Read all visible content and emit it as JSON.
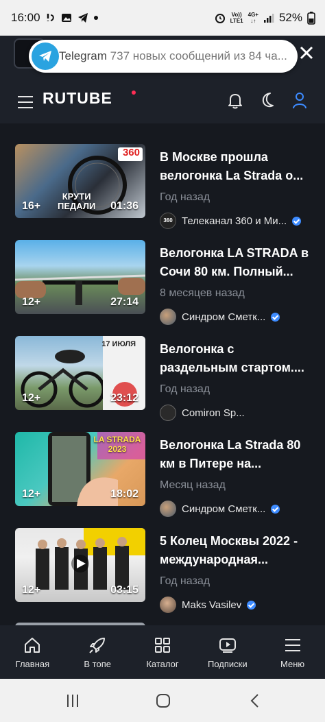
{
  "status_bar": {
    "time": "16:00",
    "network_top": "Vo))",
    "network_bottom": "LTE1",
    "network2_top": "4G+",
    "battery": "52%"
  },
  "notification": {
    "app": "Telegram",
    "message": "737 новых сообщений из 84 ча..."
  },
  "header": {
    "brand": "RUTUBE"
  },
  "videos": [
    {
      "title": "В Москве прошла велогонка La Strada о...",
      "date": "Год назад",
      "channel": "Телеканал 360 и Ми...",
      "age": "16+",
      "duration": "01:36",
      "overlay_text": "КРУТИ\nПЕДАЛИ",
      "corner_logo": "360",
      "verified": true
    },
    {
      "title": "Велогонка LA STRADA в Сочи 80 км. Полный...",
      "date": "8 месяцев назад",
      "channel": "Синдром Сметк...",
      "age": "12+",
      "duration": "27:14",
      "verified": true
    },
    {
      "title": "Велогонка с раздельным стартом....",
      "date": "Год назад",
      "channel": "Comiron Sp...",
      "age": "12+",
      "duration": "23:12",
      "overlay_text": "17 ИЮЛЯ",
      "verified": false
    },
    {
      "title": "Велогонка La Strada 80 км в Питере на...",
      "date": "Месяц назад",
      "channel": "Синдром Сметк...",
      "age": "12+",
      "duration": "18:02",
      "overlay_text": "LA STRADA 2023",
      "verified": true
    },
    {
      "title": "5 Колец Москвы 2022 - международная...",
      "date": "Год назад",
      "channel": "Maks Vasilev",
      "age": "12+",
      "duration": "03:15",
      "verified": true
    }
  ],
  "bottom_nav": [
    {
      "label": "Главная",
      "icon": "home-icon"
    },
    {
      "label": "В топе",
      "icon": "rocket-icon"
    },
    {
      "label": "Каталог",
      "icon": "grid-icon"
    },
    {
      "label": "Подписки",
      "icon": "subscriptions-icon"
    },
    {
      "label": "Меню",
      "icon": "menu-icon"
    }
  ],
  "colors": {
    "background": "#16191f",
    "header": "#1d2129",
    "accent": "#3d8bff",
    "brand_dot": "#ff2d55"
  }
}
